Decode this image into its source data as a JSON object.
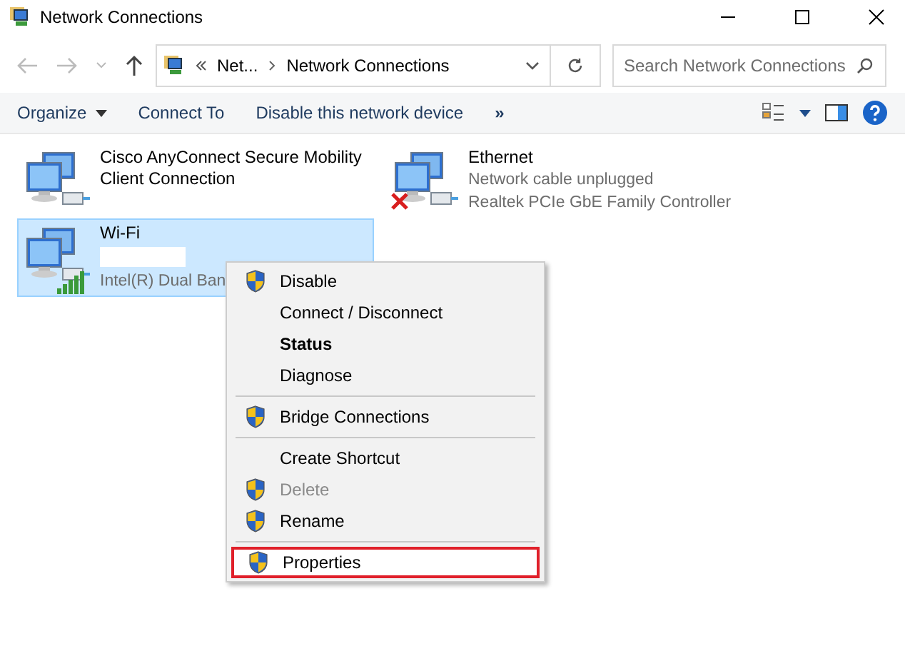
{
  "window": {
    "title": "Network Connections"
  },
  "address": {
    "breadcrumbs": [
      "Net...",
      "Network Connections"
    ],
    "search_placeholder": "Search Network Connections"
  },
  "toolbar": {
    "buttons": [
      {
        "label": "Organize",
        "dropdown": true
      },
      {
        "label": "Connect To",
        "dropdown": false
      },
      {
        "label": "Disable this network device",
        "dropdown": false
      }
    ],
    "more": "»"
  },
  "connections": [
    {
      "name": "Cisco AnyConnect Secure Mobility Client Connection",
      "kind": "none",
      "selected": false
    },
    {
      "name": "Ethernet",
      "kind": "unplugged",
      "selected": false,
      "lines": [
        "Network cable unplugged",
        "Realtek PCIe GbE Family Controller"
      ]
    },
    {
      "name": "Wi-Fi",
      "kind": "signal",
      "selected": true,
      "redacted": true,
      "lines": [
        "Intel(R) Dual Ban"
      ]
    }
  ],
  "context_menu": [
    {
      "kind": "item",
      "label": "Disable",
      "shield": true,
      "bold": false,
      "disabled": false,
      "highlighted": false
    },
    {
      "kind": "item",
      "label": "Connect / Disconnect",
      "shield": false,
      "bold": false,
      "disabled": false,
      "highlighted": false
    },
    {
      "kind": "item",
      "label": "Status",
      "shield": false,
      "bold": true,
      "disabled": false,
      "highlighted": false
    },
    {
      "kind": "item",
      "label": "Diagnose",
      "shield": false,
      "bold": false,
      "disabled": false,
      "highlighted": false
    },
    {
      "kind": "separator"
    },
    {
      "kind": "item",
      "label": "Bridge Connections",
      "shield": true,
      "bold": false,
      "disabled": false,
      "highlighted": false
    },
    {
      "kind": "separator"
    },
    {
      "kind": "item",
      "label": "Create Shortcut",
      "shield": false,
      "bold": false,
      "disabled": false,
      "highlighted": false
    },
    {
      "kind": "item",
      "label": "Delete",
      "shield": true,
      "bold": false,
      "disabled": true,
      "highlighted": false
    },
    {
      "kind": "item",
      "label": "Rename",
      "shield": true,
      "bold": false,
      "disabled": false,
      "highlighted": false
    },
    {
      "kind": "separator"
    },
    {
      "kind": "item",
      "label": "Properties",
      "shield": true,
      "bold": false,
      "disabled": false,
      "highlighted": true
    }
  ]
}
